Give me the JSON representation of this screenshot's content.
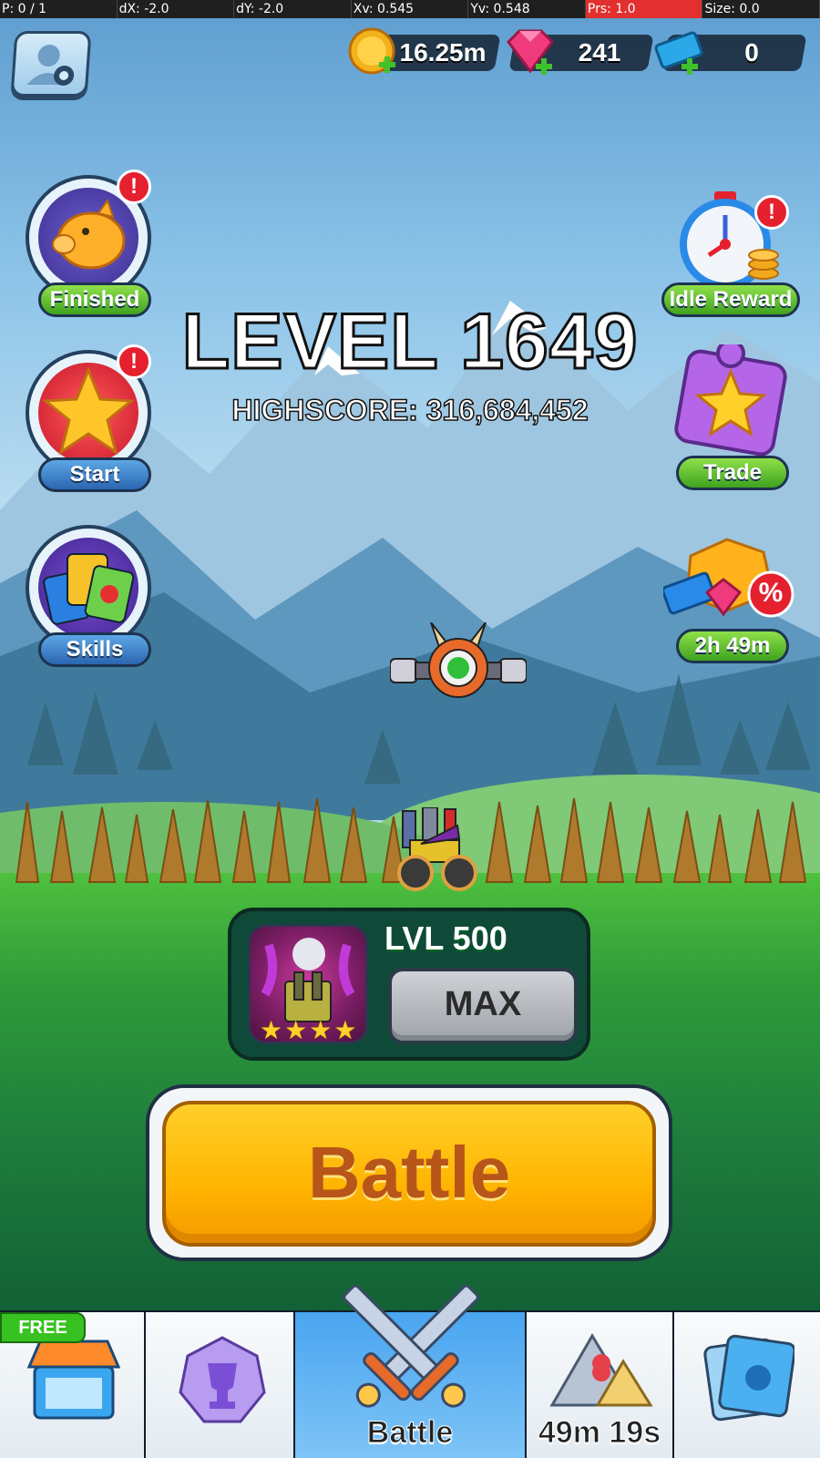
{
  "debug": {
    "pointer": "P: 0 / 1",
    "dx": "dX: -2.0",
    "dy": "dY: -2.0",
    "xv": "Xv: 0.545",
    "yv": "Yv: 0.548",
    "prs": "Prs: 1.0",
    "size": "Size: 0.0"
  },
  "currencies": {
    "coins": "16.25m",
    "gems": "241",
    "tickets": "0"
  },
  "left_buttons": [
    {
      "label": "Finished",
      "icon": "piggy-bank-icon",
      "alert": "!"
    },
    {
      "label": "Start",
      "icon": "star-icon",
      "alert": "!"
    },
    {
      "label": "Skills",
      "icon": "skill-cards-icon"
    }
  ],
  "right_buttons": [
    {
      "label": "Idle Reward",
      "icon": "stopwatch-coins-icon",
      "alert": "!"
    },
    {
      "label": "Trade",
      "icon": "puzzle-star-icon"
    },
    {
      "label": "2h 49m",
      "icon": "sale-bundle-icon",
      "badge": "%"
    }
  ],
  "level": {
    "title": "LEVEL 1649",
    "highscore": "HIGHSCORE: 316,684,452"
  },
  "weapon": {
    "level": "LVL 500",
    "max_label": "MAX",
    "stars": 4
  },
  "battle_label": "Battle",
  "bottom_nav": {
    "free_badge": "FREE",
    "tabs": [
      {
        "icon": "shop-icon",
        "label": ""
      },
      {
        "icon": "trophy-icon",
        "label": ""
      },
      {
        "icon": "crossed-swords-icon",
        "label": "Battle",
        "active": true
      },
      {
        "icon": "map-icon",
        "label": "49m 19s"
      },
      {
        "icon": "camera-card-icon",
        "label": ""
      }
    ]
  },
  "colors": {
    "accent_yellow": "#ffb400",
    "pill_green": "#3fa31f",
    "pill_blue": "#2a66b0",
    "alert_red": "#e5202f",
    "panel_green": "#0f4a38",
    "debug_red": "#e23030"
  }
}
